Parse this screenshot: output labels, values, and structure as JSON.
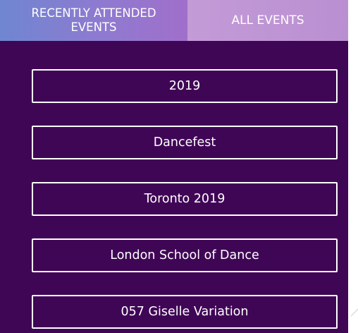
{
  "tabs": {
    "recent_label": "RECENTLY ATTENDED EVENTS",
    "all_label": "ALL EVENTS"
  },
  "events": [
    {
      "label": "2019"
    },
    {
      "label": "Dancefest"
    },
    {
      "label": "Toronto 2019"
    },
    {
      "label": "London School of Dance"
    },
    {
      "label": "057 Giselle Variation"
    }
  ],
  "colors": {
    "background": "#400656",
    "button_border": "#ffffff",
    "tab_recent": "#7f7fd0",
    "tab_all": "#c39bd6"
  }
}
